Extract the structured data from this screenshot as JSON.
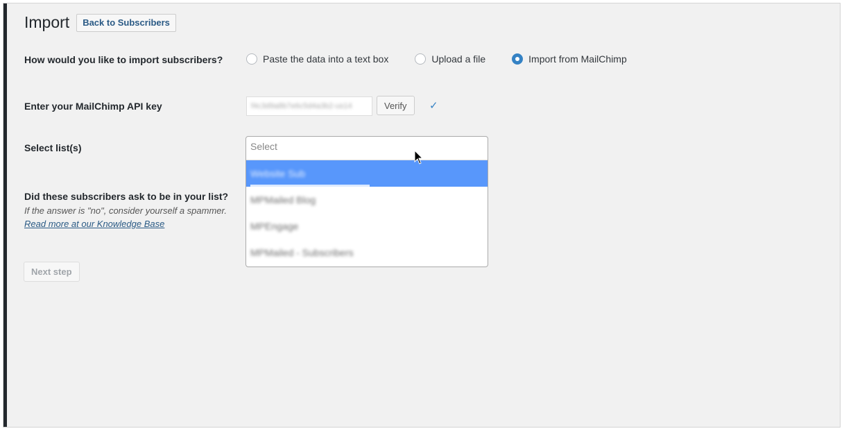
{
  "header": {
    "title": "Import",
    "back_button": "Back to Subscribers"
  },
  "import_method": {
    "question": "How would you like to import subscribers?",
    "options": [
      {
        "label": "Paste the data into a text box",
        "selected": false
      },
      {
        "label": "Upload a file",
        "selected": false
      },
      {
        "label": "Import from MailChimp",
        "selected": true
      }
    ]
  },
  "api_key": {
    "label": "Enter your MailChimp API key",
    "value": "f4c3d9a8b7e6c5d4a3b2-us14",
    "verify_button": "Verify",
    "verified_icon": "✓"
  },
  "lists": {
    "label": "Select list(s)",
    "placeholder": "Select",
    "options": [
      "Website Sub",
      "MPMailed Blog",
      "MPEngage",
      "MPMailed - Subscribers"
    ],
    "highlighted_index": 0
  },
  "consent": {
    "question": "Did these subscribers ask to be in your list?",
    "note": "If the answer is \"no\", consider yourself a spammer.",
    "link": "Read more at our Knowledge Base"
  },
  "actions": {
    "next_step": "Next step"
  },
  "colors": {
    "accent": "#3582c4",
    "highlight": "#5897fb",
    "link": "#2a5a85",
    "background": "#f1f1f1"
  }
}
